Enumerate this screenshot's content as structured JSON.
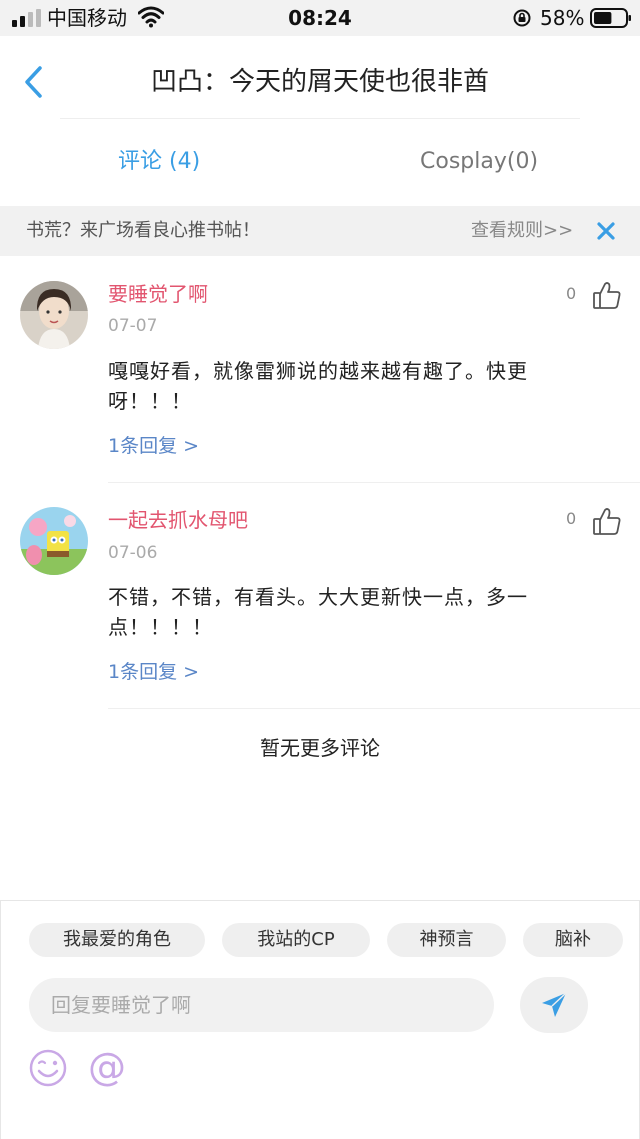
{
  "status_bar": {
    "carrier": "中国移动",
    "time": "08:24",
    "battery_percent": "58%",
    "battery_level": 0.58,
    "signal_bars": 2
  },
  "header": {
    "back_icon": "chevron-left-icon",
    "title": "凹凸：今天的屑天使也很非酋"
  },
  "tabs": [
    {
      "label": "评论 (4)",
      "active": true
    },
    {
      "label": "Cosplay(0)",
      "active": false
    }
  ],
  "notice": {
    "text": "书荒？来广场看良心推书帖！",
    "link": "查看规则>>",
    "close_icon": "close-icon"
  },
  "comments": [
    {
      "username": "要睡觉了啊",
      "date": "07-07",
      "body": "嘎嘎好看，就像雷狮说的越来越有趣了。快更呀！！！",
      "replies": "1条回复 >",
      "likes": "0"
    },
    {
      "username": "一起去抓水母吧",
      "date": "07-06",
      "body": "不错，不错，有看头。大大更新快一点，多一点！！！！",
      "replies": "1条回复 >",
      "likes": "0"
    }
  ],
  "no_more": "暂无更多评论",
  "composer": {
    "chips": [
      "我最爱的角色",
      "我站的CP",
      "神预言",
      "脑补"
    ],
    "placeholder": "回复要睡觉了啊",
    "at_symbol": "@"
  },
  "colors": {
    "accent": "#3a9ee4",
    "username": "#e2556f",
    "reply_link": "#5a86c7"
  }
}
